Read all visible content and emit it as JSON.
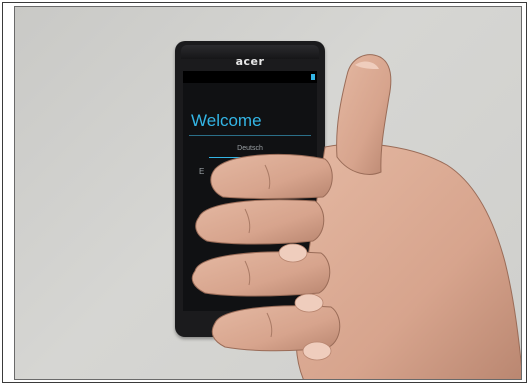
{
  "photo": {
    "phone_brand": "acer",
    "screen": {
      "title": "Welcome",
      "language": "Deutsch",
      "partial_text": "E"
    }
  },
  "colors": {
    "accent": "#33b5e5",
    "skin": "#d9a892",
    "wall": "#cfcfcc"
  },
  "icons": [
    "thumbs-up-hand-icon"
  ]
}
